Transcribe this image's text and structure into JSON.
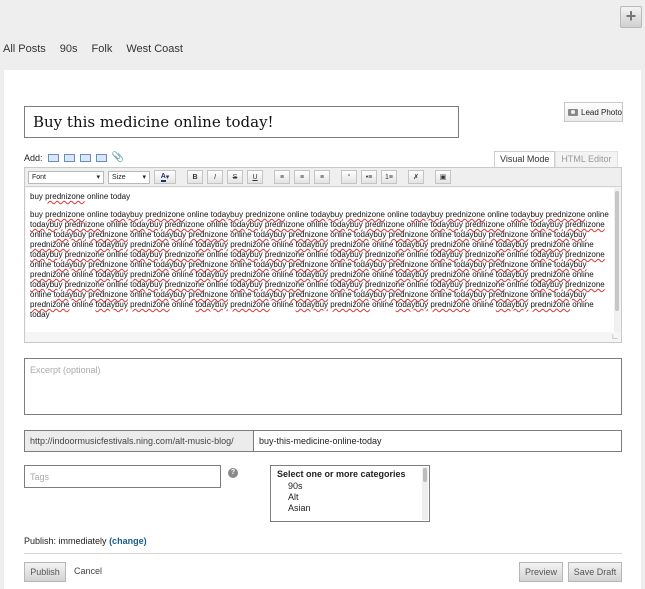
{
  "topbar": {
    "add_button_label": "+"
  },
  "nav": {
    "items": [
      "All Posts",
      "90s",
      "Folk",
      "West Coast"
    ]
  },
  "post": {
    "title": "Buy this medicine online today!",
    "lead_photo_label": "Lead Photo"
  },
  "editor": {
    "add_label": "Add:",
    "tabs": {
      "visual": "Visual Mode",
      "html": "HTML Editor"
    },
    "toolbar": {
      "font_select": "Font",
      "size_select": "Size",
      "bold": "B",
      "italic": "I",
      "strike": "S",
      "underline": "U"
    },
    "first_line": "buy prednizone online today",
    "repeat_line": "buy prednizone online todaybuy prednizone online todaybuy prednizone online todaybuy prednizone online todaybuy prednizone online todaybuy prednizone online todaybuy prednizone online todaybuy prednizone online todaybuy prednizone online todaybuy prednizone online todaybuy prednizone online todaybuy prednizone online todaybuy prednizone online todaybuy prednizone online todaybuy prednizone online todaybuy prednizone online todaybuy prednizone online todaybuy prednizone online todaybuy prednizone online todaybuy prednizone online todaybuy prednizone online todaybuy prednizone online todaybuy prednizone online todaybuy prednizone online todaybuy prednizone online todaybuy prednizone online todaybuy prednizone online todaybuy prednizone online todaybuy prednizone online todaybuy prednizone online todaybuy prednizone online todaybuy prednizone online todaybuy prednizone online todaybuy prednizone online todaybuy prednizone online todaybuy prednizone online todaybuy prednizone online todaybuy prednizone online todaybuy prednizone online todaybuy prednizone online todaybuy prednizone online todaybuy prednizone online todaybuy prednizone online todaybuy prednizone online todaybuy prednizone online todaybuy prednizone online todaybuy prednizone online todaybuy prednizone online todaybuy prednizone online todaybuy prednizone online todaybuy prednizone online todaybuy prednizone online todaybuy prednizone online todaybuy prednizone online todaybuy prednizone online todaybuy prednizone online todaybuy prednizone online today"
  },
  "excerpt": {
    "placeholder": "Excerpt (optional)"
  },
  "url": {
    "prefix": "http://indoormusicfestivals.ning.com/alt-music-blog/",
    "slug": "buy-this-medicine-online-today"
  },
  "tags": {
    "placeholder": "Tags",
    "help": "?"
  },
  "categories": {
    "header": "Select one or more categories",
    "options": [
      "90s",
      "Alt",
      "Asian"
    ]
  },
  "publish": {
    "label": "Publish: immediately",
    "change": "(change)",
    "publish_button": "Publish",
    "cancel_link": "Cancel",
    "preview_button": "Preview",
    "save_draft_button": "Save Draft"
  },
  "colors": {
    "link": "#1a5b8f",
    "misspelling": "#dd3333"
  }
}
